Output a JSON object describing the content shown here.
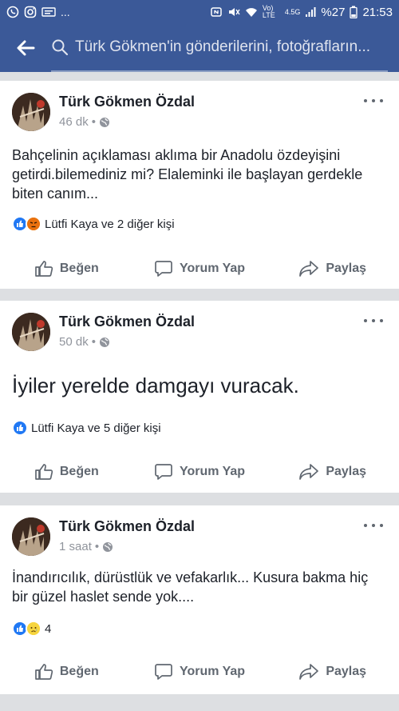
{
  "status_bar": {
    "left_icons": [
      "whatsapp-icon",
      "instagram-icon",
      "sms-icon"
    ],
    "dots": "...",
    "network_label": "Vo) LTE",
    "network_gen": "4.5G",
    "battery": "%27",
    "time": "21:53"
  },
  "search": {
    "placeholder": "Türk Gökmen'in gönderilerini, fotoğrafların..."
  },
  "posts": [
    {
      "author": "Türk Gökmen Özdal",
      "time": "46 dk",
      "privacy_icon": "globe-icon",
      "text": "Bahçelinin açıklaması aklıma bir Anadolu özdeyişini getirdi.bilemediniz mi? Elaleminki ile başlayan gerdekle biten canım...",
      "reactions": [
        "like",
        "angry"
      ],
      "reaction_text": "Lütfi Kaya ve 2 diğer kişi"
    },
    {
      "author": "Türk Gökmen Özdal",
      "time": "50 dk",
      "privacy_icon": "globe-icon",
      "text": "İyiler yerelde damgayı vuracak.",
      "reactions": [
        "like"
      ],
      "reaction_text": "Lütfi Kaya ve 5 diğer kişi"
    },
    {
      "author": "Türk Gökmen Özdal",
      "time": "1 saat",
      "privacy_icon": "globe-icon",
      "text": "İnandırıcılık, dürüstlük ve vefakarlık... Kusura bakma hiç bir güzel haslet sende yok....",
      "reactions": [
        "like",
        "sad"
      ],
      "reaction_text": "4"
    }
  ],
  "actions": {
    "like": "Beğen",
    "comment": "Yorum Yap",
    "share": "Paylaş"
  },
  "colors": {
    "brand": "#3b5998",
    "like_blue": "#2078f4",
    "text": "#1d2129",
    "meta": "#90949c"
  }
}
